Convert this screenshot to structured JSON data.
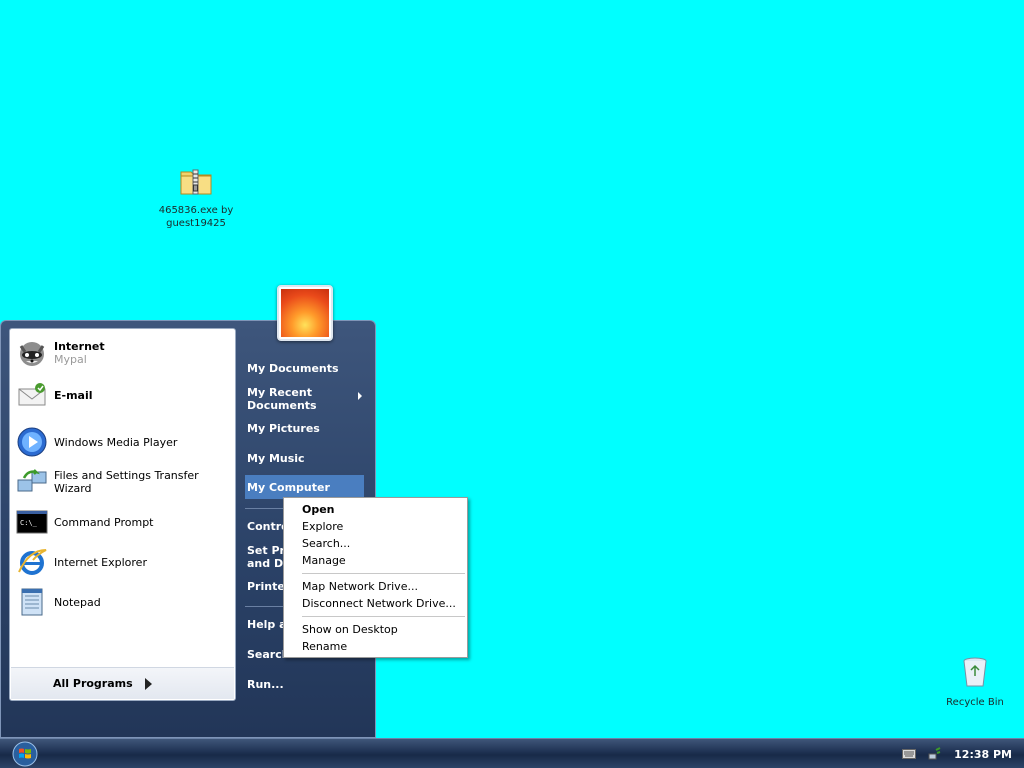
{
  "desktop": {
    "icons": [
      {
        "label": "465836.exe by guest19425",
        "icon": "zip-folder-icon"
      },
      {
        "label": "Recycle Bin",
        "icon": "recycle-bin-icon"
      }
    ],
    "background_color": "#00ffff"
  },
  "start_menu": {
    "user_picture": "flower-user-picture",
    "pinned": [
      {
        "name": "Internet",
        "sub": "Mypal",
        "icon": "raccoon-icon"
      },
      {
        "name": "E-mail",
        "icon": "envelope-icon"
      }
    ],
    "recent_programs": [
      {
        "name": "Windows Media Player",
        "icon": "media-player-icon"
      },
      {
        "name": "Files and Settings Transfer Wizard",
        "icon": "transfer-wizard-icon"
      },
      {
        "name": "Command Prompt",
        "icon": "command-prompt-icon"
      },
      {
        "name": "Internet Explorer",
        "icon": "internet-explorer-icon"
      },
      {
        "name": "Notepad",
        "icon": "notepad-icon"
      }
    ],
    "all_programs": "All Programs",
    "right_items": {
      "my_documents": "My Documents",
      "my_recent_documents_1": "My Recent",
      "my_recent_documents_2": "Documents",
      "my_pictures": "My Pictures",
      "my_music": "My Music",
      "my_computer": "My Computer",
      "control_panel": "Contro",
      "set_program_1": "Set Pro",
      "set_program_2": "and De",
      "printers": "Printer",
      "help": "Help a",
      "search": "Search",
      "run": "Run..."
    }
  },
  "context_menu": {
    "items": {
      "open": "Open",
      "explore": "Explore",
      "search": "Search...",
      "manage": "Manage",
      "map_drive": "Map Network Drive...",
      "disconnect_drive": "Disconnect Network Drive...",
      "show_desktop": "Show on Desktop",
      "rename": "Rename"
    }
  },
  "taskbar": {
    "clock": "12:38 PM",
    "tray_icons": [
      "keyboard-icon",
      "network-icon"
    ]
  }
}
